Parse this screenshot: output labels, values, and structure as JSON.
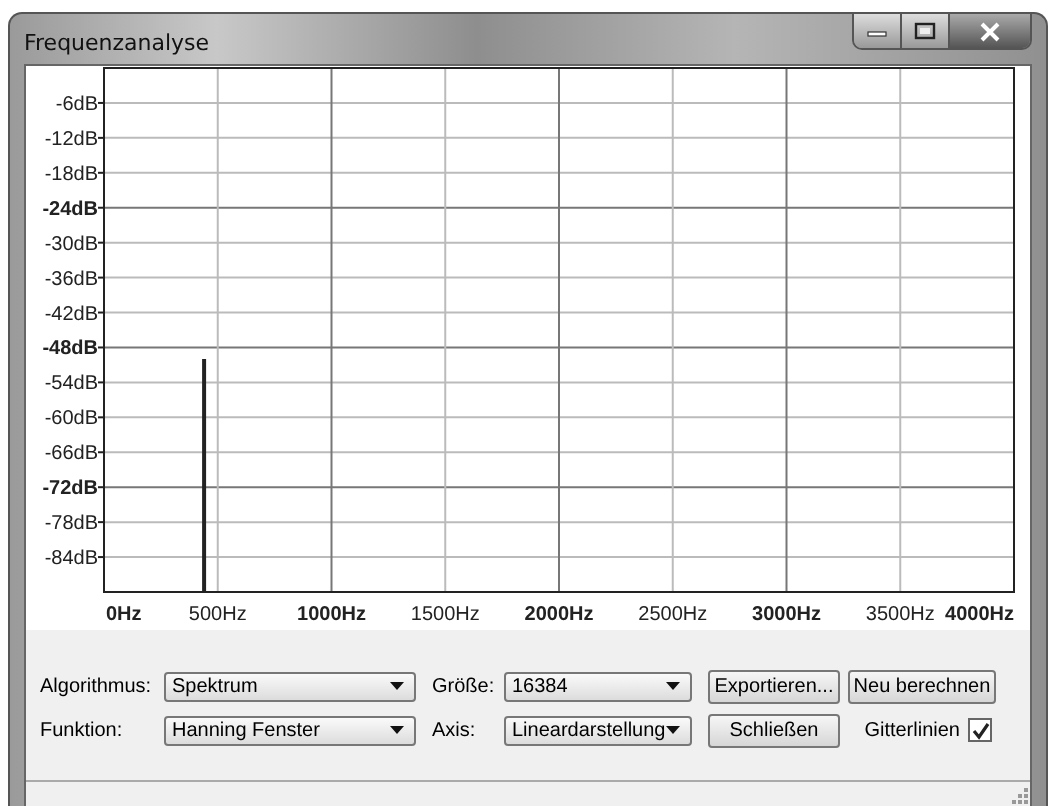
{
  "window": {
    "title": "Frequenzanalyse"
  },
  "plot": {
    "chart_data": {
      "type": "line",
      "x": [
        440,
        440
      ],
      "values": [
        -90,
        -50
      ],
      "xlim": [
        0,
        4000
      ],
      "ylim": [
        -90,
        0
      ],
      "grid": true,
      "xticks": [
        {
          "value": 0,
          "label": "0Hz"
        },
        {
          "value": 500,
          "label": "500Hz"
        },
        {
          "value": 1000,
          "label": "1000Hz"
        },
        {
          "value": 1500,
          "label": "1500Hz"
        },
        {
          "value": 2000,
          "label": "2000Hz"
        },
        {
          "value": 2500,
          "label": "2500Hz"
        },
        {
          "value": 3000,
          "label": "3000Hz"
        },
        {
          "value": 3500,
          "label": "3500Hz"
        },
        {
          "value": 4000,
          "label": "4000Hz"
        }
      ],
      "yticks": [
        {
          "value": -6,
          "label": "-6dB"
        },
        {
          "value": -12,
          "label": "-12dB"
        },
        {
          "value": -18,
          "label": "-18dB"
        },
        {
          "value": -24,
          "label": "-24dB"
        },
        {
          "value": -30,
          "label": "-30dB"
        },
        {
          "value": -36,
          "label": "-36dB"
        },
        {
          "value": -42,
          "label": "-42dB"
        },
        {
          "value": -48,
          "label": "-48dB"
        },
        {
          "value": -54,
          "label": "-54dB"
        },
        {
          "value": -60,
          "label": "-60dB"
        },
        {
          "value": -66,
          "label": "-66dB"
        },
        {
          "value": -72,
          "label": "-72dB"
        },
        {
          "value": -78,
          "label": "-78dB"
        },
        {
          "value": -84,
          "label": "-84dB"
        }
      ]
    }
  },
  "controls": [
    {
      "kind": "combo",
      "label": "Algorithmus:",
      "value": "Spektrum"
    },
    {
      "kind": "combo",
      "label": "Größe:",
      "value": "16384"
    },
    {
      "kind": "button",
      "label": "Exportieren..."
    },
    {
      "kind": "button",
      "label": "Neu berechnen"
    },
    {
      "kind": "combo",
      "label": "Funktion:",
      "value": "Hanning Fenster"
    },
    {
      "kind": "combo",
      "label": "Axis:",
      "value": "Lineardarstellung"
    },
    {
      "kind": "button",
      "label": "Schließen"
    },
    {
      "kind": "checkbox",
      "label": "Gitterlinien",
      "checked": true
    }
  ]
}
